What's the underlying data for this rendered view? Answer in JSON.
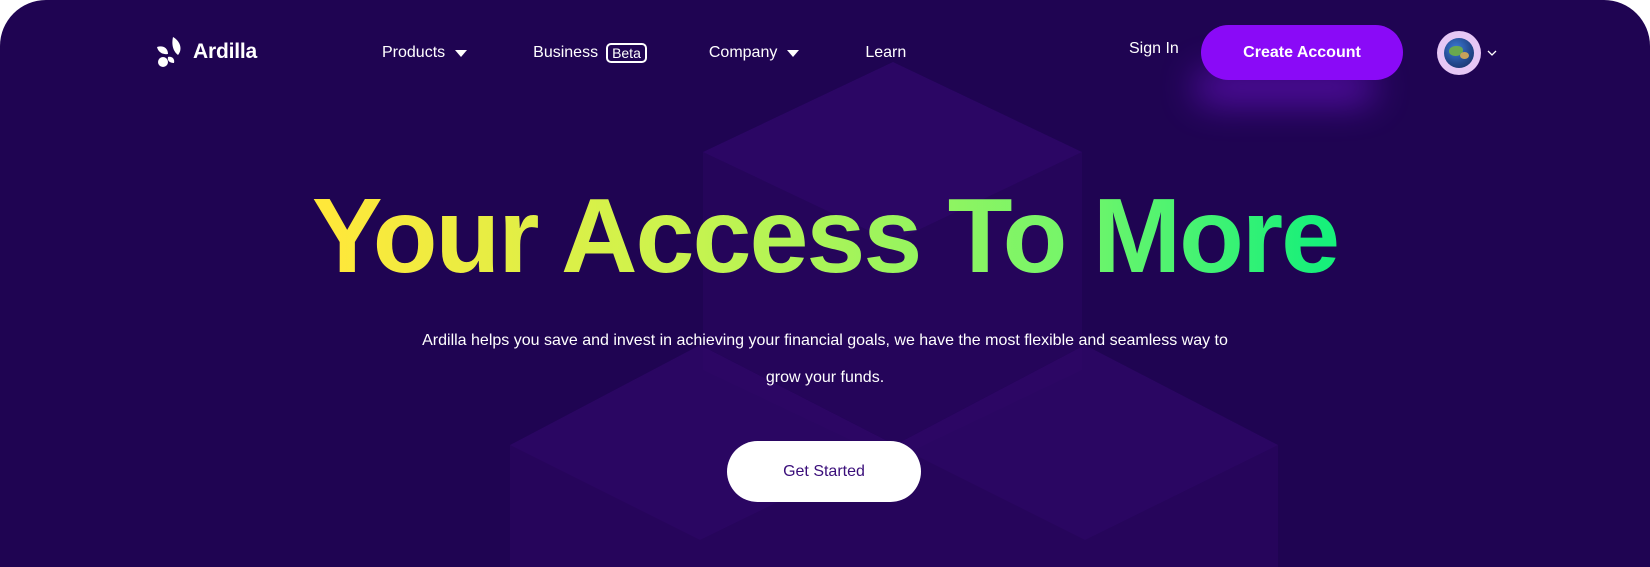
{
  "brand": {
    "name": "Ardilla",
    "logo_icon": "ardilla-leaf-logo"
  },
  "nav": {
    "products_label": "Products",
    "business_label": "Business",
    "business_badge": "Beta",
    "company_label": "Company",
    "learn_label": "Learn"
  },
  "header": {
    "sign_in_label": "Sign In",
    "create_account_label": "Create Account",
    "language_icon": "globe-icon"
  },
  "hero": {
    "title": "Your Access To More",
    "description": "Ardilla helps you save and invest in achieving your financial goals, we have the most flexible and seamless way to grow your funds.",
    "cta_label": "Get Started"
  },
  "colors": {
    "background": "#1f0452",
    "accent": "#8a0af7",
    "gradient_start": "#ffe83a",
    "gradient_end": "#17f07a"
  }
}
